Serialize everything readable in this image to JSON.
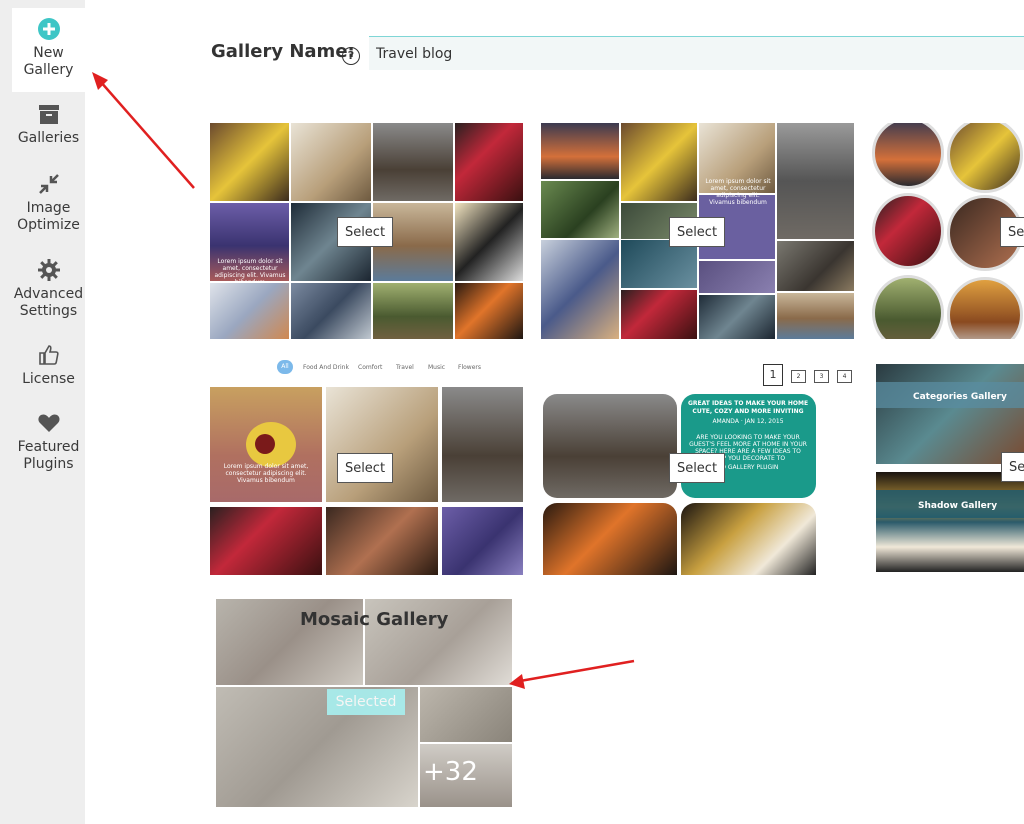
{
  "sidebar": {
    "items": [
      {
        "label": "New\nGallery",
        "icon": "plus-circle-icon"
      },
      {
        "label": "Galleries",
        "icon": "archive-box-icon"
      },
      {
        "label": "Image\nOptimize",
        "icon": "compress-arrows-icon"
      },
      {
        "label": "Advanced\nSettings",
        "icon": "gear-icon"
      },
      {
        "label": "License",
        "icon": "thumbs-up-icon"
      },
      {
        "label": "Featured\nPlugins",
        "icon": "heart-icon"
      }
    ]
  },
  "header": {
    "label": "Gallery Name:",
    "help": "?",
    "input_value": "Travel blog"
  },
  "templates": {
    "select_label": "Select",
    "grid1_caption": "Lorem ipsum dolor sit amet, consectetur adipiscing elit. Vivamus bibendum",
    "filters": [
      "All",
      "Food And Drink",
      "Comfort",
      "Travel",
      "Music",
      "Flowers"
    ],
    "pages": [
      "1",
      "2",
      "3",
      "4"
    ],
    "card_caption_1": "GREAT IDEAS TO MAKE YOUR HOME CUTE, COZY AND MORE INVITING",
    "card_caption_2": "AMANDA · JAN 12, 2015",
    "card_caption_3": "ARE YOU LOOKING TO MAKE YOUR GUEST'S FEEL MORE AT HOME IN YOUR SPACE? HERE ARE A FEW IDEAS TO HELP YOU DECORATE TO",
    "card_caption_4": "TO GALLERY PLUGIN",
    "category_gallery": "Categories Gallery",
    "shadow_gallery": "Shadow Gallery",
    "mosaic_title": "Mosaic Gallery",
    "selected_label": "Selected",
    "more_count": "+32"
  },
  "colors": {
    "accent": "#3ec6c6",
    "arrow": "#e02020"
  }
}
